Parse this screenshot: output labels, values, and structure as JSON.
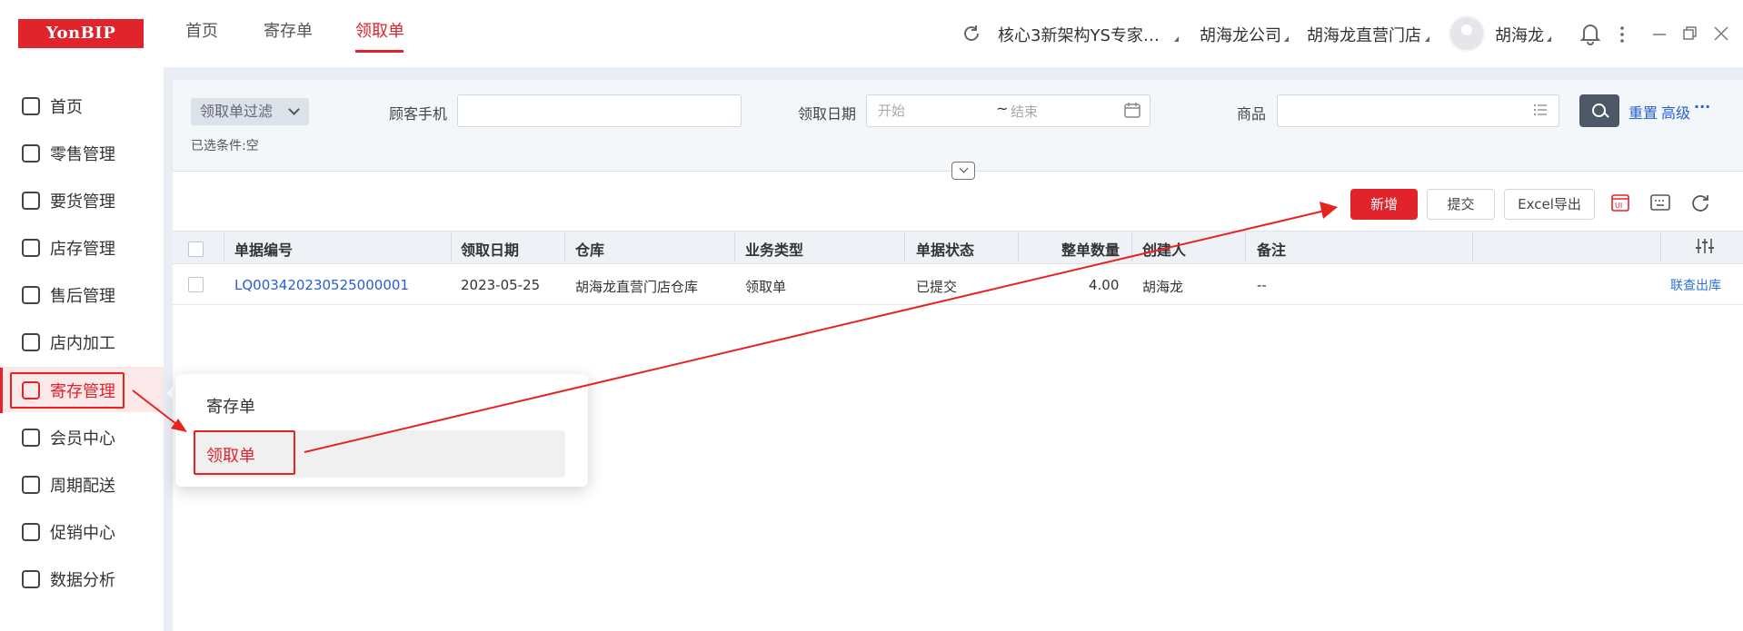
{
  "app": {
    "logo": "YonBIP"
  },
  "top_tabs": [
    {
      "label": "首页",
      "active": false
    },
    {
      "label": "寄存单",
      "active": false
    },
    {
      "label": "领取单",
      "active": true
    }
  ],
  "top_right": {
    "org": "核心3新架构YS专家…",
    "company": "胡海龙公司",
    "store": "胡海龙直营门店",
    "user": "胡海龙"
  },
  "sidebar": {
    "items": [
      {
        "label": "首页",
        "icon": "home-icon"
      },
      {
        "label": "零售管理",
        "icon": "bag-icon"
      },
      {
        "label": "要货管理",
        "icon": "inbox-icon"
      },
      {
        "label": "店存管理",
        "icon": "store-icon"
      },
      {
        "label": "售后管理",
        "icon": "service-icon"
      },
      {
        "label": "店内加工",
        "icon": "tools-icon"
      },
      {
        "label": "寄存管理",
        "icon": "deposit-icon",
        "active": true
      },
      {
        "label": "会员中心",
        "icon": "crown-icon"
      },
      {
        "label": "周期配送",
        "icon": "truck-icon"
      },
      {
        "label": "促销中心",
        "icon": "tag-icon"
      },
      {
        "label": "数据分析",
        "icon": "chart-icon"
      }
    ]
  },
  "flyout": {
    "items": [
      {
        "label": "寄存单"
      },
      {
        "label": "领取单",
        "highlighted": true
      }
    ]
  },
  "filter": {
    "scheme": "领取单过滤",
    "phone_label": "顾客手机",
    "phone_value": "",
    "date_label": "领取日期",
    "date_start_placeholder": "开始",
    "date_sep": "~",
    "date_end_placeholder": "结束",
    "product_label": "商品",
    "product_value": "",
    "reset": "重置",
    "advanced": "高级",
    "more": "···",
    "selected": "已选条件:空"
  },
  "toolbar": {
    "add": "新增",
    "submit": "提交",
    "export": "Excel导出"
  },
  "table": {
    "columns": [
      "单据编号",
      "领取日期",
      "仓库",
      "业务类型",
      "单据状态",
      "整单数量",
      "创建人",
      "备注"
    ],
    "rows": [
      {
        "code": "LQ003420230525000001",
        "date": "2023-05-25",
        "warehouse": "胡海龙直营门店仓库",
        "biz_type": "领取单",
        "status": "已提交",
        "qty": "4.00",
        "creator": "胡海龙",
        "remark": "--",
        "action": "联查出库"
      }
    ]
  },
  "colors": {
    "brand_red": "#e1232b",
    "annotation_red": "#e8231f",
    "link_blue": "#2660d0"
  }
}
